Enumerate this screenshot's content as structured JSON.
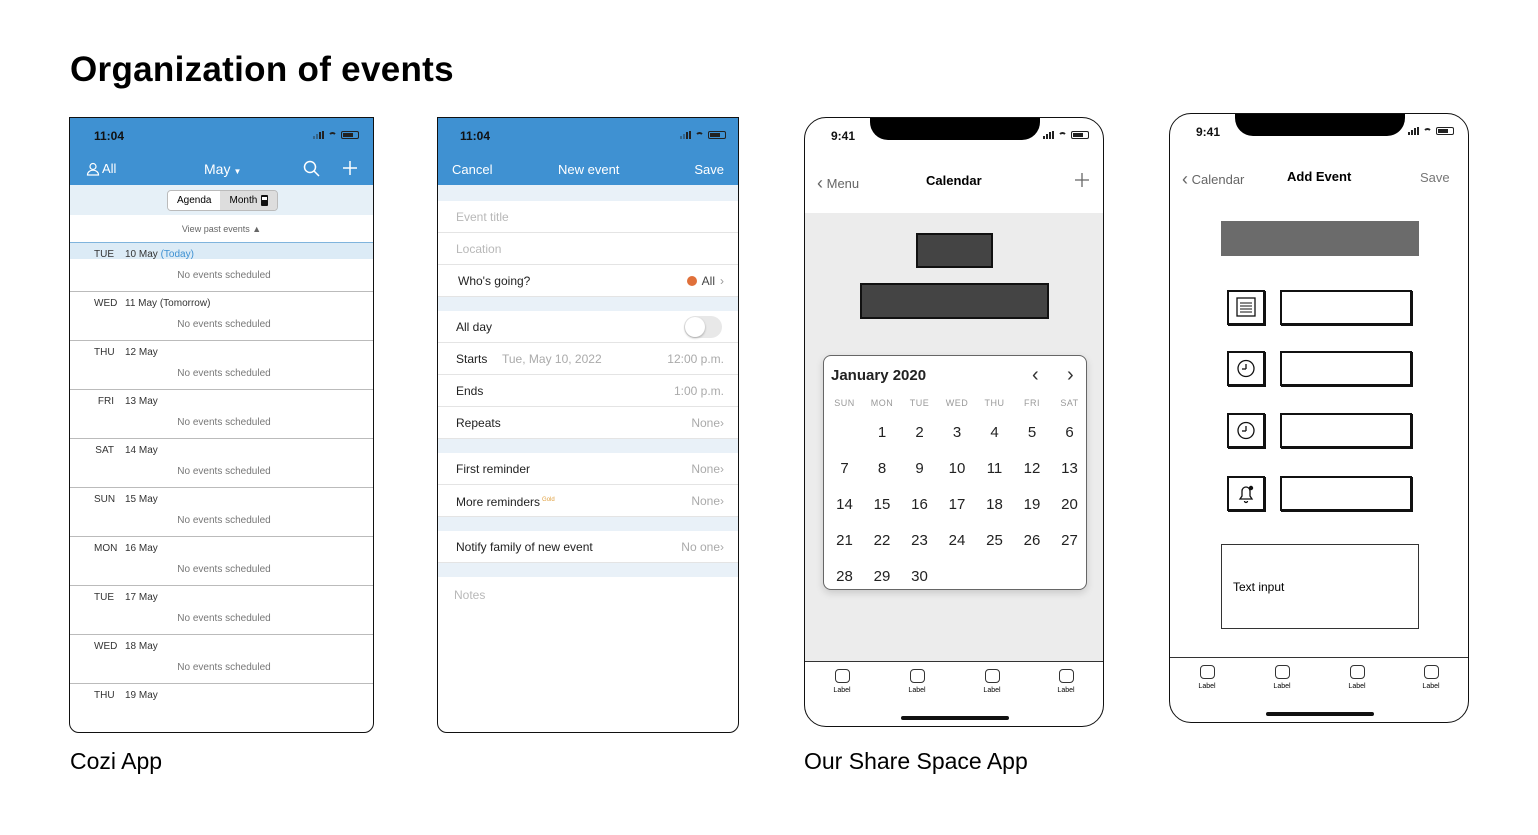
{
  "page_title": "Organization of events",
  "captions": {
    "left": "Cozi App",
    "right": "Our Share Space App"
  },
  "cozi_agenda": {
    "time": "11:04",
    "all_label": "All",
    "month_label": "May",
    "segments": [
      "Agenda",
      "Month"
    ],
    "view_past": "View past events",
    "days": [
      {
        "name": "TUE",
        "date": "10 May",
        "suffix": "(Today)",
        "note": "No events scheduled"
      },
      {
        "name": "WED",
        "date": "11 May",
        "suffix": "(Tomorrow)",
        "note": "No events scheduled"
      },
      {
        "name": "THU",
        "date": "12 May",
        "suffix": "",
        "note": "No events scheduled"
      },
      {
        "name": "FRI",
        "date": "13 May",
        "suffix": "",
        "note": "No events scheduled"
      },
      {
        "name": "SAT",
        "date": "14 May",
        "suffix": "",
        "note": "No events scheduled"
      },
      {
        "name": "SUN",
        "date": "15 May",
        "suffix": "",
        "note": "No events scheduled"
      },
      {
        "name": "MON",
        "date": "16 May",
        "suffix": "",
        "note": "No events scheduled"
      },
      {
        "name": "TUE",
        "date": "17 May",
        "suffix": "",
        "note": "No events scheduled"
      },
      {
        "name": "WED",
        "date": "18 May",
        "suffix": "",
        "note": "No events scheduled"
      },
      {
        "name": "THU",
        "date": "19 May",
        "suffix": "",
        "note": ""
      }
    ]
  },
  "cozi_new_event": {
    "time": "11:04",
    "cancel": "Cancel",
    "title": "New event",
    "save": "Save",
    "event_title_placeholder": "Event title",
    "location_placeholder": "Location",
    "whos_going": {
      "label": "Who's going?",
      "value": "All"
    },
    "all_day": "All day",
    "starts": {
      "label": "Starts",
      "date": "Tue, May 10, 2022",
      "time": "12:00 p.m."
    },
    "ends": {
      "label": "Ends",
      "time": "1:00 p.m."
    },
    "repeats": {
      "label": "Repeats",
      "value": "None"
    },
    "first_reminder": {
      "label": "First reminder",
      "value": "None"
    },
    "more_reminders": {
      "label": "More reminders",
      "badge": "Gold",
      "value": "None"
    },
    "notify": {
      "label": "Notify family of new event",
      "value": "No one"
    },
    "notes_placeholder": "Notes",
    "accent_color": "#3f91d2",
    "dot_color": "#e0703a"
  },
  "share_calendar": {
    "time": "9:41",
    "back": "Menu",
    "title": "Calendar",
    "month": "January 2020",
    "dow": [
      "SUN",
      "MON",
      "TUE",
      "WED",
      "THU",
      "FRI",
      "SAT"
    ],
    "first_weekday": 1,
    "days_in_month": 30,
    "tabs": [
      "Label",
      "Label",
      "Label",
      "Label"
    ]
  },
  "share_add_event": {
    "time": "9:41",
    "back": "Calendar",
    "title": "Add Event",
    "save": "Save",
    "text_input": "Text input",
    "icons": [
      "list-icon",
      "clock-icon",
      "clock-icon",
      "bell-icon"
    ],
    "tabs": [
      "Label",
      "Label",
      "Label",
      "Label"
    ]
  }
}
